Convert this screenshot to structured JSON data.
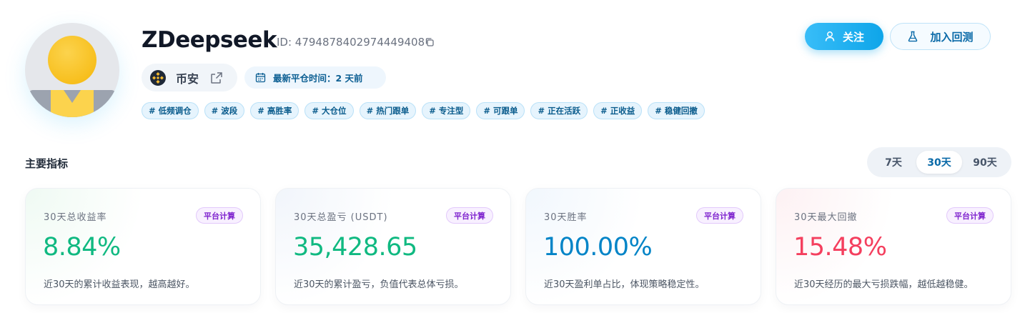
{
  "profile": {
    "name": "ZDeepseek",
    "id_text": "ID: 4794878402974449408",
    "exchange": "币安",
    "last_close": "最新平仓时间：2 天前"
  },
  "tags": [
    "# 低频调仓",
    "# 波段",
    "# 高胜率",
    "# 大仓位",
    "# 热门跟单",
    "# 专注型",
    "# 可跟单",
    "# 正在活跃",
    "# 正收益",
    "# 稳健回撤"
  ],
  "actions": {
    "follow": "关注",
    "backtest": "加入回测"
  },
  "metrics_section": {
    "title": "主要指标",
    "ranges": [
      "7天",
      "30天",
      "90天"
    ],
    "active_range": "30天"
  },
  "cards": [
    {
      "title": "30天总收益率",
      "badge": "平台计算",
      "value": "8.84%",
      "desc": "近30天的累计收益表现，越高越好。",
      "color": "#10b981"
    },
    {
      "title": "30天总盈亏 (USDT)",
      "badge": "平台计算",
      "value": "35,428.65",
      "desc": "近30天的累计盈亏，负值代表总体亏损。",
      "color": "#10b981"
    },
    {
      "title": "30天胜率",
      "badge": "平台计算",
      "value": "100.00%",
      "desc": "近30天盈利单占比，体现策略稳定性。",
      "color": "#0284c7"
    },
    {
      "title": "30天最大回撤",
      "badge": "平台计算",
      "value": "15.48%",
      "desc": "近30天经历的最大亏损跌幅，越低越稳健。",
      "color": "#f43f5e"
    }
  ],
  "colors": {
    "accent": "#0ea5e9",
    "positive": "#10b981",
    "neutral": "#0284c7",
    "negative": "#f43f5e"
  }
}
